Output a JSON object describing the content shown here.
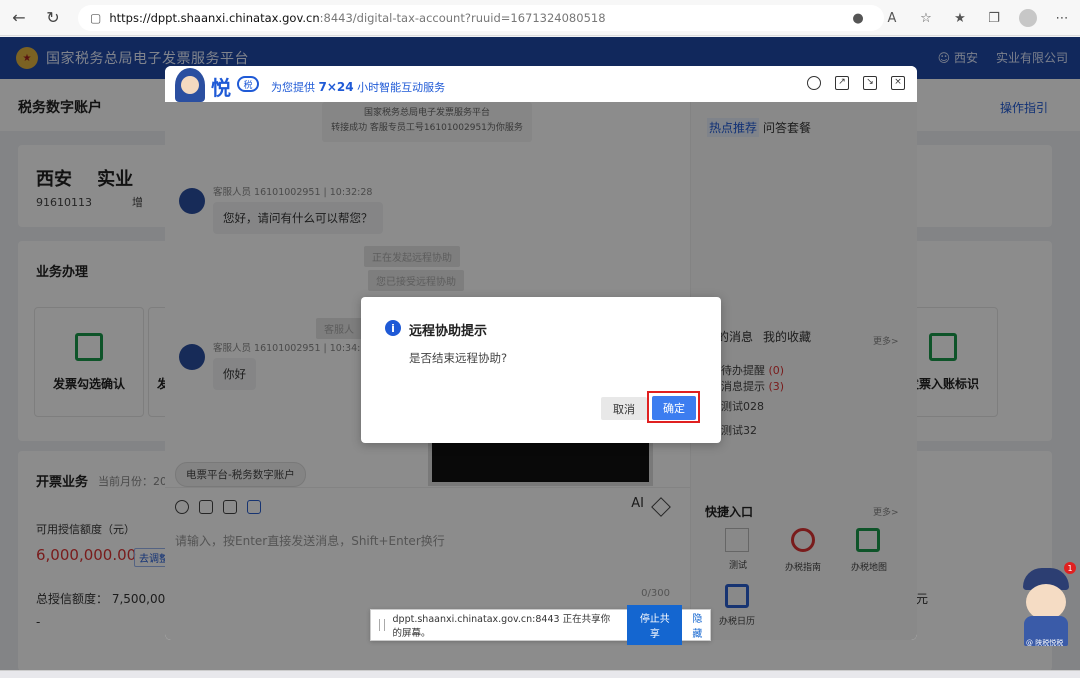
{
  "browser": {
    "url_domain": "https://dppt.shaanxi.chinatax.gov.cn",
    "url_rest": ":8443/digital-tax-account?ruuid=1671324080518"
  },
  "site": {
    "title": "国家税务总局电子发票服务平台",
    "user": "西安",
    "company_short": "实业有限公司"
  },
  "page": {
    "subtitle": "税务数字账户",
    "guide": "操作指引",
    "company": "西安",
    "company_suffix": "实业",
    "tax_id": "91610113",
    "tax_id_tail": "增",
    "business_title": "业务办理",
    "tiles": [
      {
        "label": "发票勾选确认"
      },
      {
        "label": "发"
      },
      {
        "label": "发票入账标识"
      }
    ],
    "invoicing_title": "开票业务",
    "current_month": "当前月份：20",
    "credit_label": "可用授信额度（元）",
    "credit_value": "6,000,000.00",
    "credit_tag": "去调整",
    "total_credit": "总授信额度：  7,500,000",
    "dash": "-",
    "yuan": "元"
  },
  "chat": {
    "brand": "悦",
    "brand_badge": "税",
    "slogan_pre": "为您提供",
    "slogan_hl": "7×24",
    "slogan_post": "小时智能互动服务",
    "sys_line1": "国家税务总局电子发票服务平台",
    "sys_line2": "转接成功 客服专员工号16101002951为你服务",
    "msg1_meta": "客服人员 16101002951 | 10:32:28",
    "msg1_text": "您好，请问有什么可以帮您？",
    "notice1": "正在发起远程协助",
    "notice2": "您已接受远程协助",
    "notice3": "客服人",
    "msg2_meta": "客服人员 16101002951 | 10:34:09",
    "msg2_text": "你好",
    "chip": "电票平台-税务数字账户",
    "ai": "AI",
    "input_placeholder": "请输入，按Enter直接发送消息，Shift+Enter换行",
    "counter": "0/300",
    "side": {
      "tab_hot": "热点推荐",
      "tab_qa": "问答套餐",
      "msg_tab": "的消息",
      "fav_tab": "我的收藏",
      "more1": "更多>",
      "todo": "待办提醒",
      "todo_count": "(0)",
      "notice": "消息提示",
      "notice_count": "(3)",
      "test1": "测试028",
      "test2": "测试32",
      "quick_title": "快捷入口",
      "more2": "更多>",
      "q1": "测试",
      "q2": "办税指南",
      "q3": "办税地图",
      "q4": "办税日历"
    }
  },
  "dialog": {
    "icon": "i",
    "title": "远程协助提示",
    "text": "是否结束远程协助?",
    "cancel": "取消",
    "ok": "确定"
  },
  "share_bar": {
    "text": "dppt.shaanxi.chinatax.gov.cn:8443 正在共享你的屏幕。",
    "stop": "停止共享",
    "hide": "隐藏"
  },
  "float": {
    "badge": "1",
    "label": "@ 陕税悦税"
  },
  "colors": {
    "brand_blue": "#1f4aa8",
    "primary": "#3c7df0",
    "highlight_red": "#e02020"
  }
}
